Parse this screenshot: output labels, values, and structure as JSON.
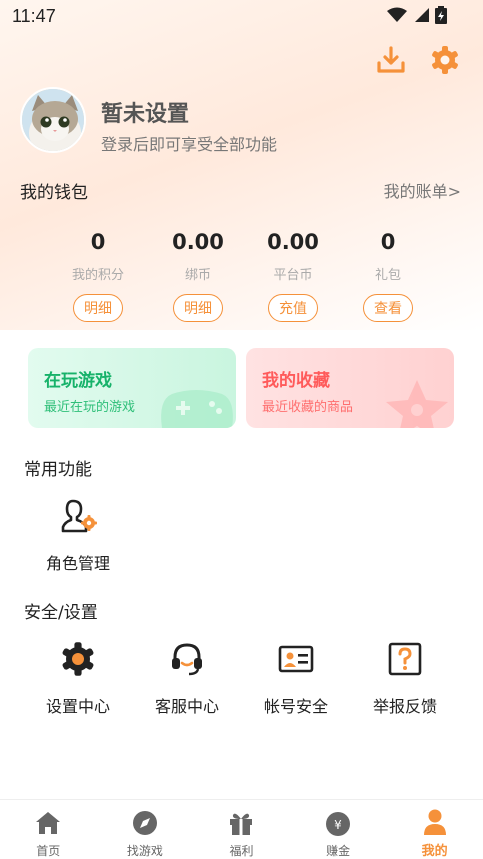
{
  "status_bar": {
    "time": "11:47"
  },
  "profile": {
    "name": "暂未设置",
    "subtitle": "登录后即可享受全部功能"
  },
  "wallet": {
    "title": "我的钱包",
    "bill_link": "我的账单>",
    "items": [
      {
        "value": "0",
        "label": "我的积分",
        "button": "明细"
      },
      {
        "value": "0.00",
        "label": "绑币",
        "button": "明细"
      },
      {
        "value": "0.00",
        "label": "平台币",
        "button": "充值"
      },
      {
        "value": "0",
        "label": "礼包",
        "button": "查看"
      }
    ]
  },
  "cards": [
    {
      "title": "在玩游戏",
      "subtitle": "最近在玩的游戏"
    },
    {
      "title": "我的收藏",
      "subtitle": "最近收藏的商品"
    }
  ],
  "common": {
    "title": "常用功能",
    "items": [
      {
        "label": "角色管理",
        "icon": "role-manage-icon"
      }
    ]
  },
  "security": {
    "title": "安全/设置",
    "items": [
      {
        "label": "设置中心",
        "icon": "gear-icon"
      },
      {
        "label": "客服中心",
        "icon": "headset-icon"
      },
      {
        "label": "帐号安全",
        "icon": "id-card-icon"
      },
      {
        "label": "举报反馈",
        "icon": "question-icon"
      }
    ]
  },
  "nav": {
    "items": [
      {
        "label": "首页",
        "icon": "home-icon"
      },
      {
        "label": "找游戏",
        "icon": "compass-icon"
      },
      {
        "label": "福利",
        "icon": "gift-icon"
      },
      {
        "label": "赚金",
        "icon": "money-bag-icon"
      },
      {
        "label": "我的",
        "icon": "user-icon"
      }
    ],
    "active_index": 4
  },
  "colors": {
    "accent": "#f5913a",
    "green": "#17b26a",
    "red": "#ff5a5a",
    "icon_dark": "#222222",
    "nav_icon": "#666666"
  }
}
